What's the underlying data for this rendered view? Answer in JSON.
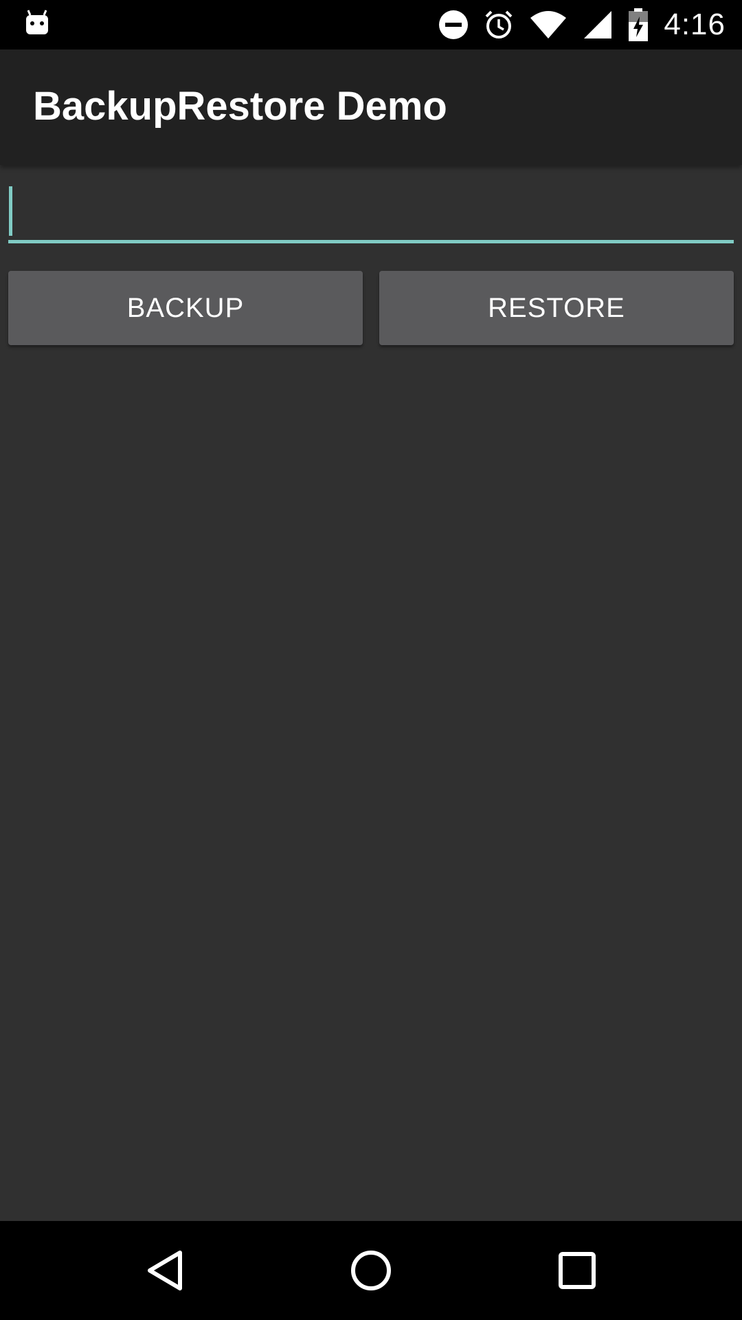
{
  "status_bar": {
    "time": "4:16",
    "icons": [
      "android-notification-icon",
      "do-not-disturb-icon",
      "alarm-icon",
      "wifi-icon",
      "cell-signal-icon",
      "battery-charging-icon"
    ]
  },
  "app_bar": {
    "title": "BackupRestore Demo"
  },
  "main": {
    "text_input": {
      "value": "",
      "placeholder": ""
    },
    "backup_label": "BACKUP",
    "restore_label": "RESTORE"
  },
  "nav_bar": {
    "buttons": [
      "back",
      "home",
      "recents"
    ]
  },
  "colors": {
    "accent": "#80cbc4",
    "background": "#303030",
    "app_bar": "#212121",
    "button": "#5a5a5c"
  }
}
